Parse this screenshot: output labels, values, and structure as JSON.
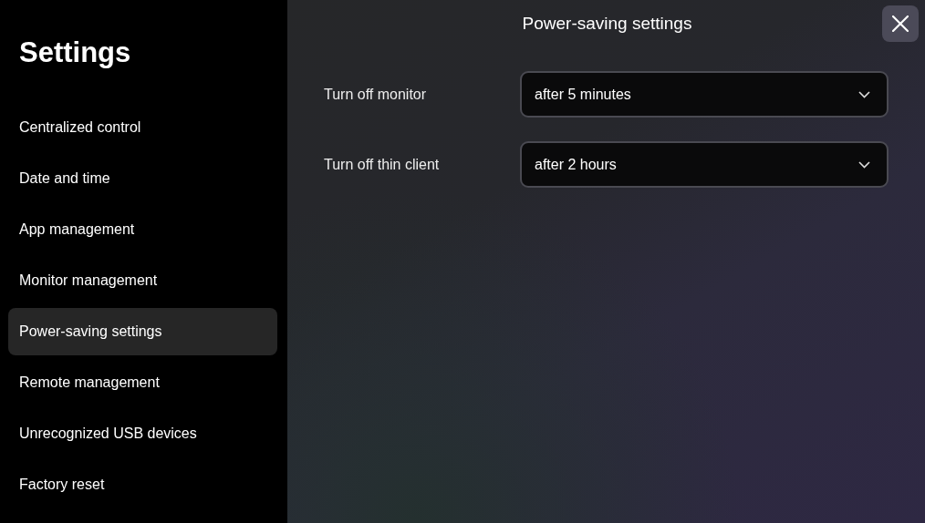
{
  "sidebar": {
    "title": "Settings",
    "items": [
      {
        "label": "Centralized control",
        "selected": false
      },
      {
        "label": "Date and time",
        "selected": false
      },
      {
        "label": "App management",
        "selected": false
      },
      {
        "label": "Monitor management",
        "selected": false
      },
      {
        "label": "Power-saving settings",
        "selected": true
      },
      {
        "label": "Remote management",
        "selected": false
      },
      {
        "label": "Unrecognized USB devices",
        "selected": false
      },
      {
        "label": "Factory reset",
        "selected": false
      }
    ]
  },
  "panel": {
    "title": "Power-saving settings",
    "settings": [
      {
        "label": "Turn off monitor",
        "value": "after 5 minutes"
      },
      {
        "label": "Turn off thin client",
        "value": "after 2 hours"
      }
    ]
  }
}
